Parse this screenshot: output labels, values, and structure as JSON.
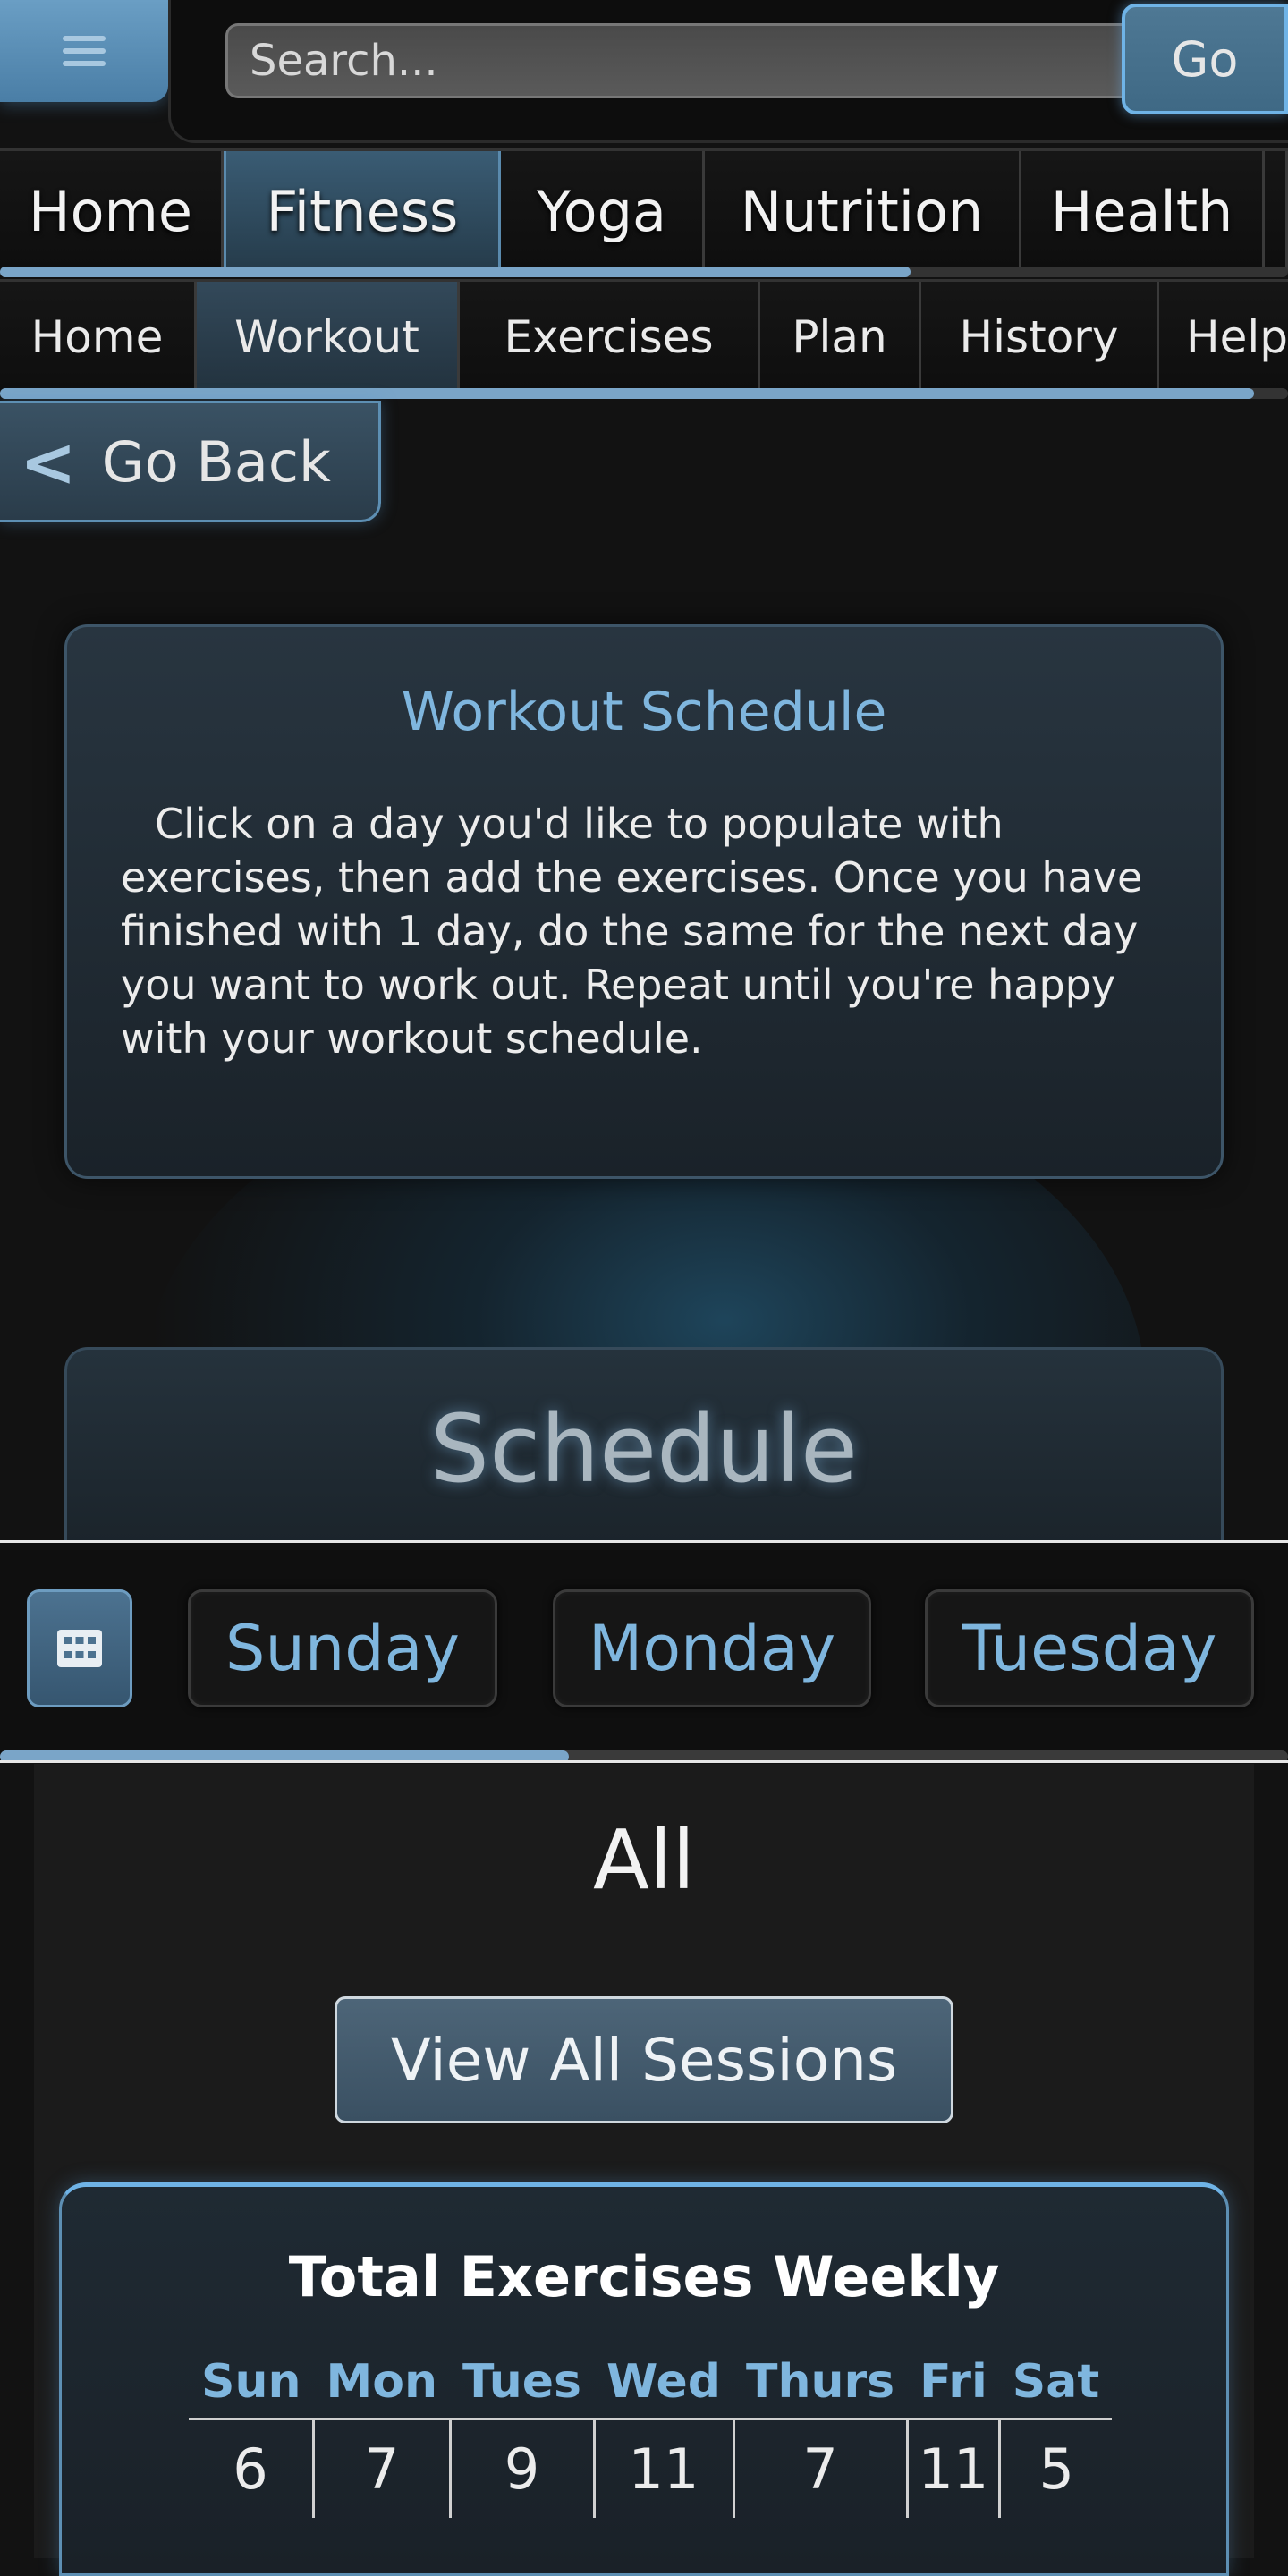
{
  "header": {
    "search_placeholder": "Search...",
    "go_label": "Go",
    "menu_icon": "hamburger-icon"
  },
  "nav_primary": {
    "tabs": [
      {
        "label": "Home"
      },
      {
        "label": "Fitness",
        "active": true
      },
      {
        "label": "Yoga"
      },
      {
        "label": "Nutrition"
      },
      {
        "label": "Health"
      }
    ]
  },
  "nav_secondary": {
    "tabs": [
      {
        "label": "Home"
      },
      {
        "label": "Workout",
        "active": true
      },
      {
        "label": "Exercises"
      },
      {
        "label": "Plan"
      },
      {
        "label": "History"
      },
      {
        "label": "Help"
      }
    ]
  },
  "back": {
    "label": "Go Back",
    "icon": "chevron-left-icon"
  },
  "info": {
    "title": "Workout Schedule",
    "body": "Click on a day you'd like to populate with exercises, then add the exercises. Once you have finished with 1 day, do the same for the next day you want to work out. Repeat until you're happy with your workout schedule."
  },
  "schedule": {
    "title": "Schedule",
    "calendar_icon": "calendar-grid-icon",
    "days": [
      "Sunday",
      "Monday",
      "Tuesday"
    ]
  },
  "sessions": {
    "filter_label": "All",
    "view_all_label": "View All Sessions"
  },
  "weekly_totals": {
    "title": "Total Exercises Weekly",
    "days": [
      "Sun",
      "Mon",
      "Tues",
      "Wed",
      "Thurs",
      "Fri",
      "Sat"
    ],
    "counts": [
      "6",
      "7",
      "9",
      "11",
      "7",
      "11",
      "5"
    ]
  },
  "colors": {
    "accent": "#7fb6de",
    "background": "#121212",
    "active_tab": "#3a5c74"
  }
}
